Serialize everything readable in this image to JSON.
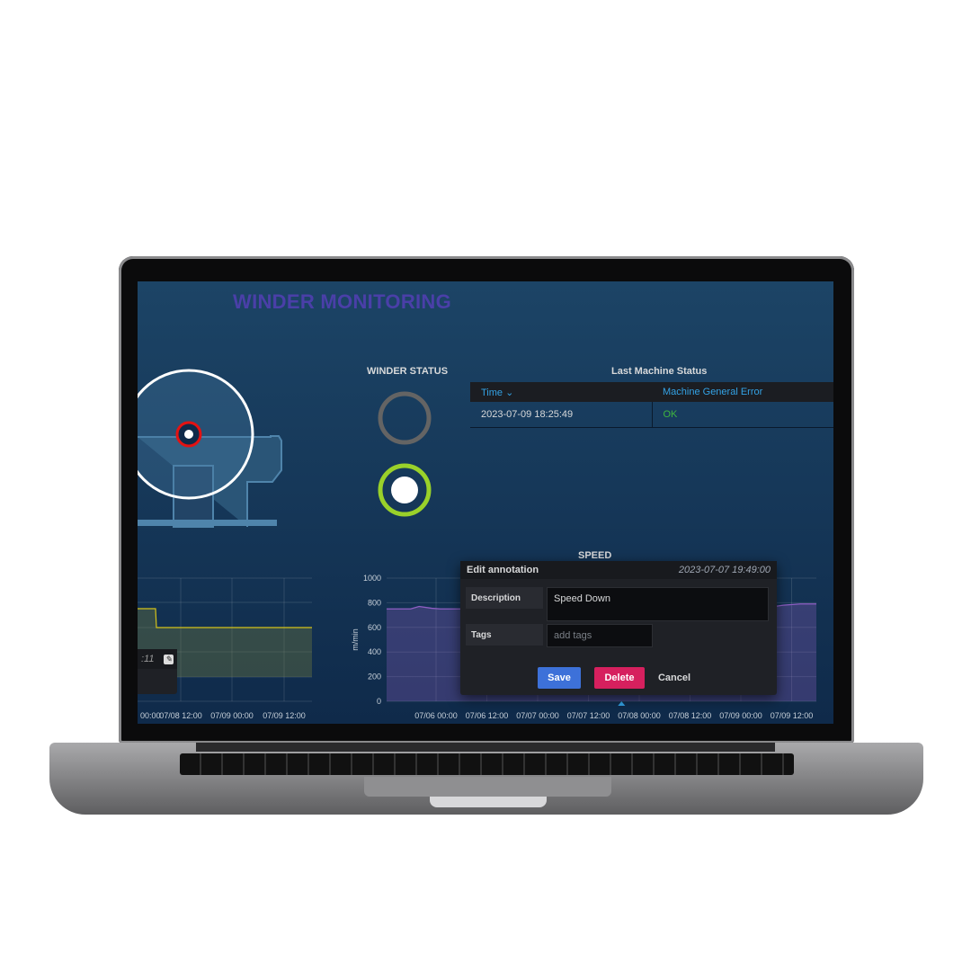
{
  "dashboard": {
    "title": "WINDER MONITORING"
  },
  "winder_status": {
    "title": "WINDER STATUS",
    "indicators": [
      {
        "state": "off",
        "color": "#646464"
      },
      {
        "state": "on",
        "color": "#9ad12a"
      }
    ]
  },
  "last_status": {
    "title": "Last Machine Status",
    "columns": [
      "Time",
      "Machine General Error"
    ],
    "rows": [
      {
        "time": "2023-07-09 18:25:49",
        "error": "OK"
      }
    ],
    "ok_color": "#3fb53f",
    "header_color": "#33a2e5"
  },
  "left_chart": {
    "x_ticks": [
      "00:00",
      "07/08 12:00",
      "07/09 00:00",
      "07/09 12:00"
    ],
    "tooltip_fragment": ":11",
    "line_color": "#d4c21a"
  },
  "speed": {
    "title": "SPEED"
  },
  "chart_data": {
    "type": "area",
    "ylabel": "m/min",
    "ylim": [
      0,
      1000
    ],
    "y_ticks": [
      "0",
      "200",
      "400",
      "600",
      "800",
      "1000"
    ],
    "x_ticks": [
      "07/06 00:00",
      "07/06 12:00",
      "07/07 00:00",
      "07/07 12:00",
      "07/08 00:00",
      "07/08 12:00",
      "07/09 00:00",
      "07/09 12:00"
    ],
    "series": [
      {
        "color": "#8f5fc4",
        "x": [
          "07/05 12:00",
          "07/05 18:00",
          "07/05 20:00",
          "07/05 23:00",
          "07/06 01:00",
          "07/07 12:00",
          "07/09 06:00",
          "07/09 10:00",
          "07/09 14:00"
        ],
        "y": [
          750,
          750,
          770,
          755,
          750,
          750,
          760,
          780,
          790
        ]
      }
    ],
    "annotation": {
      "time": "2023-07-07 19:49:00"
    }
  },
  "annotation_editor": {
    "title": "Edit annotation",
    "time": "2023-07-07 19:49:00",
    "description_label": "Description",
    "description_value": "Speed Down",
    "tags_label": "Tags",
    "tags_placeholder": "add tags",
    "save": "Save",
    "delete": "Delete",
    "cancel": "Cancel"
  }
}
